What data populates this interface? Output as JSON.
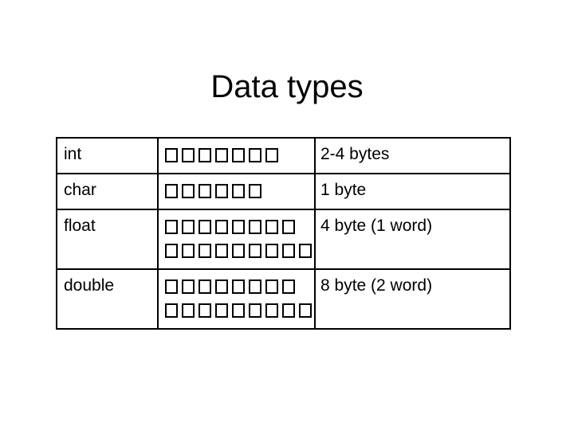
{
  "slide": {
    "title": "Data types",
    "background_color": "#ffffff",
    "text_color": "#000000",
    "border_color": "#000000"
  },
  "table": {
    "rows": [
      {
        "name": "int",
        "boxes_lines": [
          7
        ],
        "size": "2-4 bytes"
      },
      {
        "name": "char",
        "boxes_lines": [
          6
        ],
        "size": "1 byte"
      },
      {
        "name": "float",
        "boxes_lines": [
          8,
          9
        ],
        "size": "4 byte (1 word)"
      },
      {
        "name": "double",
        "boxes_lines": [
          8,
          9
        ],
        "size": "8 byte (2 word)"
      }
    ],
    "glyph": {
      "missing_glyph_name": "missing-glyph-box",
      "character": "□"
    }
  }
}
